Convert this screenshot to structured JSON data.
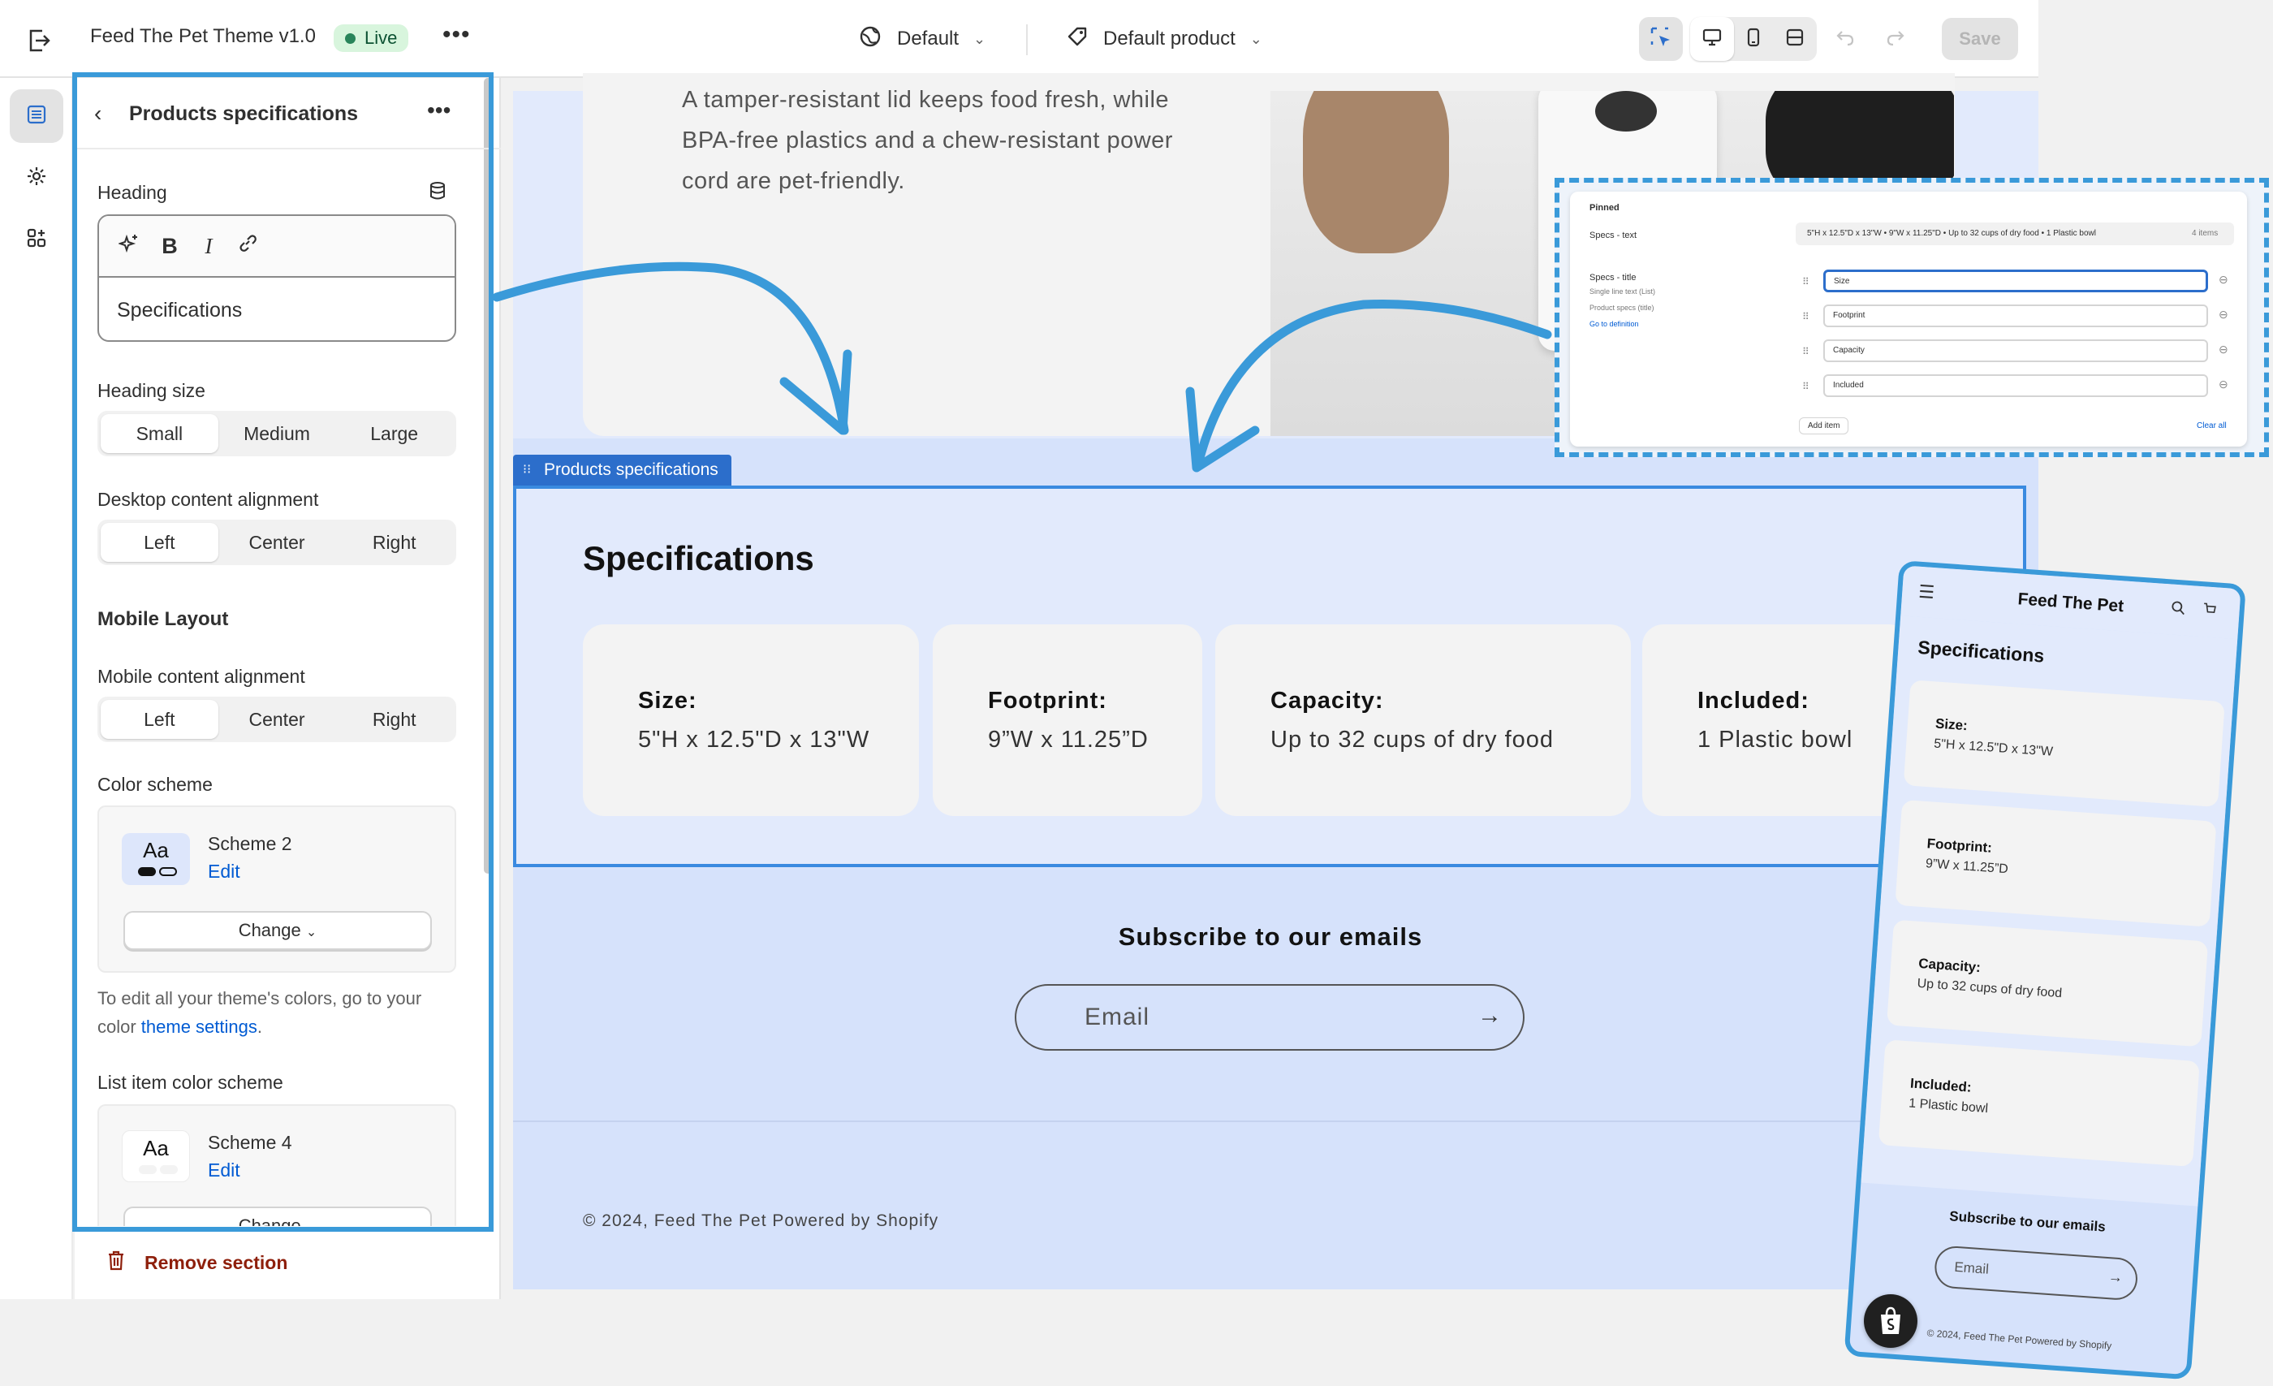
{
  "topbar": {
    "theme_name": "Feed The Pet Theme v1.0",
    "status_badge": "Live",
    "more_label": "•••",
    "template_label": "Default",
    "product_label": "Default product",
    "save_label": "Save"
  },
  "panel": {
    "title": "Products specifications",
    "more_label": "•••",
    "heading_label": "Heading",
    "heading_value": "Specifications",
    "heading_size_label": "Heading size",
    "heading_size_options": [
      "Small",
      "Medium",
      "Large"
    ],
    "heading_size_selected": "Small",
    "desktop_align_label": "Desktop content alignment",
    "desktop_align_options": [
      "Left",
      "Center",
      "Right"
    ],
    "mobile_layout_label": "Mobile Layout",
    "mobile_align_label": "Mobile content alignment",
    "mobile_align_options": [
      "Left",
      "Center",
      "Right"
    ],
    "color_scheme_label": "Color scheme",
    "color_scheme": {
      "swatch": "Aa",
      "name": "Scheme 2",
      "edit": "Edit",
      "change": "Change"
    },
    "help_text_prefix": "To edit all your theme's colors, go to your color ",
    "help_link": "theme settings",
    "help_text_suffix": ".",
    "list_color_scheme_label": "List item color scheme",
    "list_color_scheme": {
      "swatch": "Aa",
      "name": "Scheme 4",
      "edit": "Edit",
      "change": "Change"
    },
    "remove_label": "Remove section"
  },
  "preview": {
    "hero_text": "A tamper-resistant lid keeps food fresh, while BPA-free plastics and a chew-resistant power cord are pet-friendly.",
    "section_tag": "Products specifications",
    "specs_title": "Specifications",
    "specs": [
      {
        "key": "Size:",
        "value": "5\"H x 12.5\"D x 13\"W"
      },
      {
        "key": "Footprint:",
        "value": "9”W x 11.25”D"
      },
      {
        "key": "Capacity:",
        "value": "Up to 32 cups of dry food"
      },
      {
        "key": "Included:",
        "value": "1 Plastic bowl"
      }
    ],
    "subscribe_title": "Subscribe to our emails",
    "email_placeholder": "Email",
    "copyright": "© 2024, Feed The Pet Powered by Shopify"
  },
  "admin_inset": {
    "pinned": "Pinned",
    "specs_text_label": "Specs - text",
    "specs_text_value": "5\"H x 12.5\"D x 13\"W • 9\"W x 11.25\"D • Up to 32 cups of dry food • 1 Plastic bowl",
    "specs_text_count": "4 items",
    "specs_title_label": "Specs - title",
    "specs_title_type": "Single line text (List)",
    "specs_title_desc": "Product specs (title)",
    "definition_link": "Go to definition",
    "items": [
      "Size",
      "Footprint",
      "Capacity",
      "Included"
    ],
    "add_item": "Add item",
    "clear_all": "Clear all"
  },
  "phone": {
    "brand": "Feed The Pet",
    "specs_title": "Specifications",
    "subscribe_title": "Subscribe to our emails",
    "email_placeholder": "Email",
    "copyright": "© 2024, Feed The Pet Powered by Shopify"
  },
  "colors": {
    "accent": "#3a9ad9",
    "section_outline": "#3a8ae0",
    "preview_bg": "#d6e2fb",
    "link": "#005bd3",
    "danger": "#8e1f0b"
  }
}
